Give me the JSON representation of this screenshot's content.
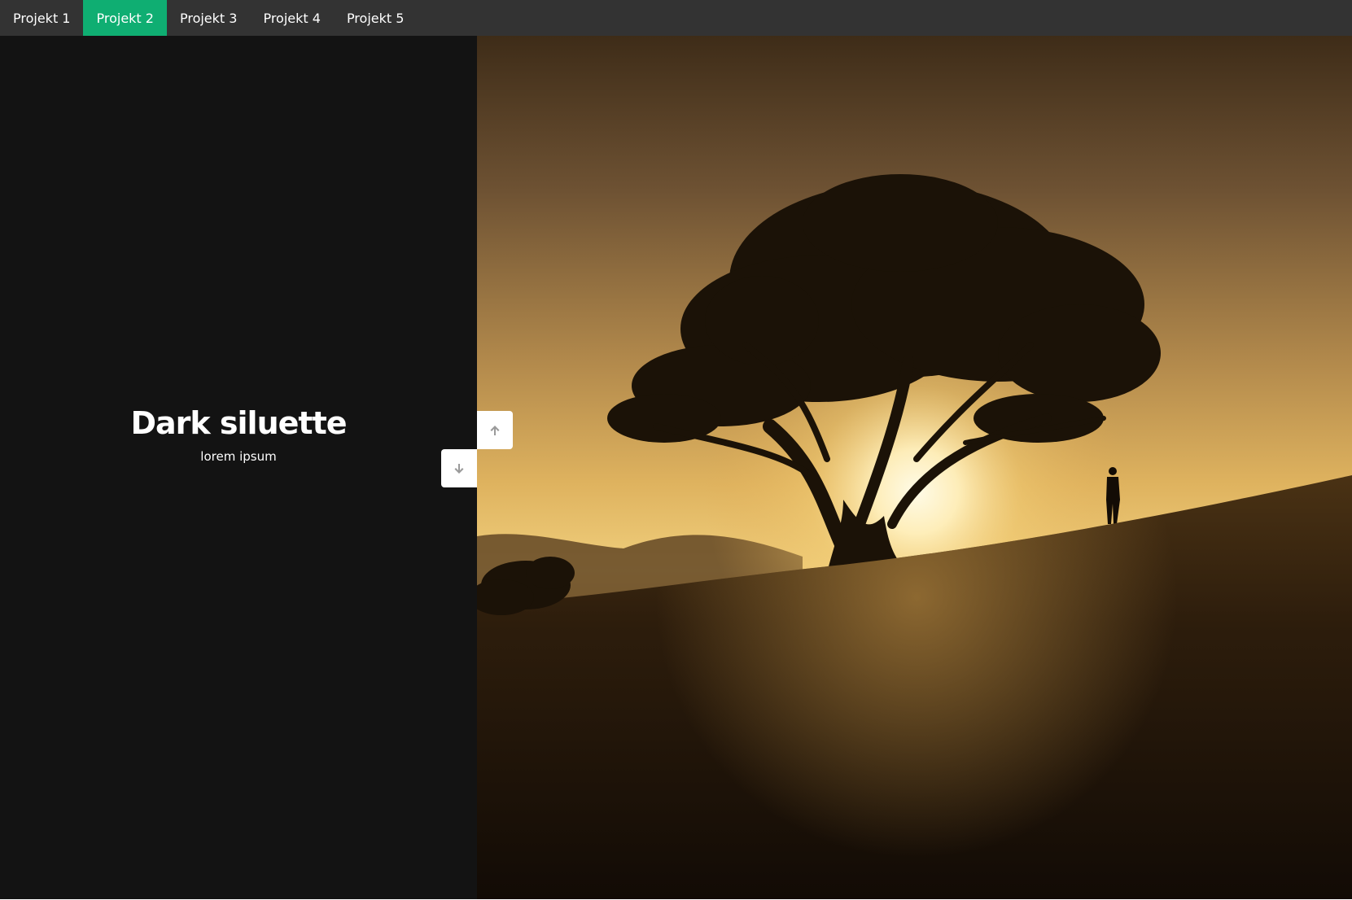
{
  "nav": {
    "items": [
      {
        "label": "Projekt 1",
        "active": false
      },
      {
        "label": "Projekt 2",
        "active": true
      },
      {
        "label": "Projekt 3",
        "active": false
      },
      {
        "label": "Projekt 4",
        "active": false
      },
      {
        "label": "Projekt 5",
        "active": false
      }
    ],
    "active_color": "#0fae72",
    "background_color": "#333333"
  },
  "slide": {
    "title": "Dark siluette",
    "subtitle": "lorem ipsum",
    "panel_color": "#131313"
  },
  "controls": {
    "up_icon": "arrow-up-icon",
    "down_icon": "arrow-down-icon"
  }
}
